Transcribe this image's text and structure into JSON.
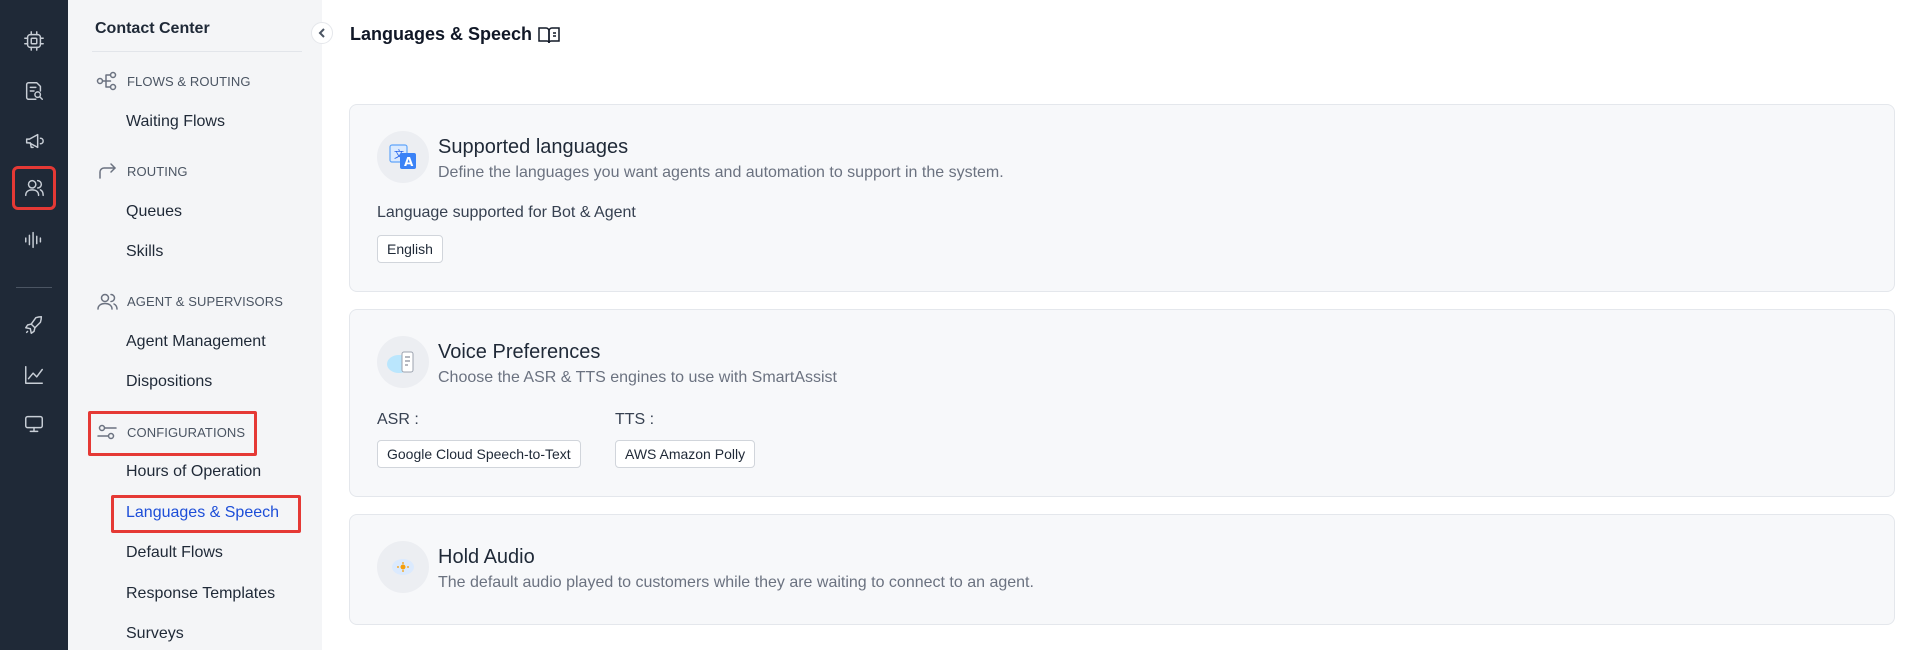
{
  "rail": {
    "items": [
      {
        "icon": "settings-chip-icon",
        "active": false
      },
      {
        "icon": "document-search-icon",
        "active": false
      },
      {
        "icon": "megaphone-icon",
        "active": false
      },
      {
        "icon": "users-icon",
        "active": true
      },
      {
        "icon": "audio-wave-icon",
        "active": false
      },
      {
        "icon": "rocket-icon",
        "active": false
      },
      {
        "icon": "analytics-icon",
        "active": false
      },
      {
        "icon": "monitor-icon",
        "active": false
      }
    ]
  },
  "nav": {
    "title": "Contact Center",
    "sections": {
      "flows": {
        "label": "FLOWS & ROUTING",
        "icon": "flow-icon",
        "items": [
          "Waiting Flows"
        ]
      },
      "routing": {
        "label": "ROUTING",
        "icon": "routing-arrow-icon",
        "items": [
          "Queues",
          "Skills"
        ]
      },
      "agents": {
        "label": "AGENT & SUPERVISORS",
        "icon": "users-icon",
        "items": [
          "Agent Management",
          "Dispositions"
        ]
      },
      "config": {
        "label": "CONFIGURATIONS",
        "icon": "sliders-icon",
        "items": [
          "Hours of Operation",
          "Languages & Speech",
          "Default Flows",
          "Response Templates",
          "Surveys"
        ]
      }
    },
    "selected_item": "Languages & Speech",
    "highlight_color": "#e53935",
    "selected_color": "#1d4ed8"
  },
  "main": {
    "title": "Languages & Speech",
    "title_icon": "open-book-icon",
    "cards": {
      "languages": {
        "title": "Supported languages",
        "description": "Define the languages you want agents and automation to support in the system.",
        "icon": "translate-icon",
        "field_label": "Language supported for Bot & Agent",
        "chips": [
          "English"
        ]
      },
      "voice": {
        "title": "Voice Preferences",
        "description": "Choose the ASR & TTS engines to use with SmartAssist",
        "icon": "voice-engine-icon",
        "asr_label": "ASR :",
        "asr_value": "Google Cloud Speech-to-Text",
        "tts_label": "TTS :",
        "tts_value": "AWS Amazon Polly"
      },
      "hold": {
        "title": "Hold Audio",
        "description": "The default audio played to customers while they are waiting to connect to an agent.",
        "icon": "hold-audio-icon"
      }
    }
  }
}
